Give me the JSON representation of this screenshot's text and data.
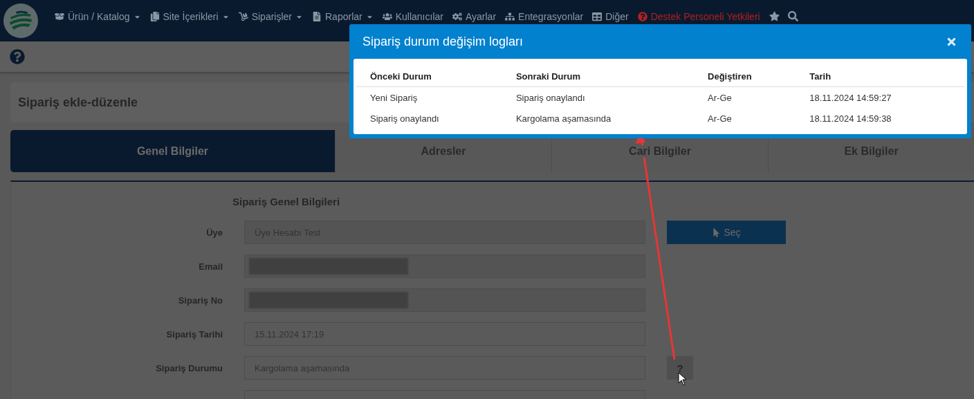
{
  "nav": {
    "items": [
      {
        "label": "Ürün / Katalog",
        "dropdown": true,
        "highlight": false
      },
      {
        "label": "Site İçerikleri",
        "dropdown": true,
        "highlight": false
      },
      {
        "label": "Siparişler",
        "dropdown": true,
        "highlight": false
      },
      {
        "label": "Raporlar",
        "dropdown": true,
        "highlight": false
      },
      {
        "label": "Kullanıcılar",
        "dropdown": false,
        "highlight": false
      },
      {
        "label": "Ayarlar",
        "dropdown": false,
        "highlight": false
      },
      {
        "label": "Entegrasyonlar",
        "dropdown": false,
        "highlight": false
      },
      {
        "label": "Diğer",
        "dropdown": false,
        "highlight": false
      },
      {
        "label": "Destek Personeli Yetkileri",
        "dropdown": false,
        "highlight": true
      }
    ]
  },
  "page": {
    "title": "Sipariş ekle-düzenle",
    "tabs": [
      {
        "label": "Genel Bilgiler",
        "selected": true
      },
      {
        "label": "Adresler",
        "selected": false
      },
      {
        "label": "Cari Bilgiler",
        "selected": false
      },
      {
        "label": "Ek Bilgiler",
        "selected": false
      }
    ],
    "section_title": "Sipariş Genel Bilgileri",
    "fields": [
      {
        "kind": "text",
        "label": "Üye",
        "value": "Üye Hesabı Test",
        "action": {
          "kind": "select",
          "label": "Seç"
        }
      },
      {
        "kind": "redacted",
        "label": "Email"
      },
      {
        "kind": "redacted",
        "label": "Sipariş No"
      },
      {
        "kind": "text",
        "label": "Sipariş Tarihi",
        "value": "15.11.2024 17:19"
      },
      {
        "kind": "text",
        "label": "Sipariş Durumu",
        "value": "Kargolama aşamasında",
        "action": {
          "kind": "help",
          "label": "?"
        }
      },
      {
        "kind": "blank"
      }
    ]
  },
  "modal": {
    "title": "Sipariş durum değişim logları",
    "columns": [
      "Önceki Durum",
      "Sonraki Durum",
      "Değiştiren",
      "Tarih"
    ],
    "rows": [
      [
        "Yeni Sipariş",
        "Sipariş onaylandı",
        "Ar-Ge",
        "18.11.2024 14:59:27"
      ],
      [
        "Sipariş onaylandı",
        "Kargolama aşamasında",
        "Ar-Ge",
        "18.11.2024 14:59:38"
      ]
    ]
  }
}
